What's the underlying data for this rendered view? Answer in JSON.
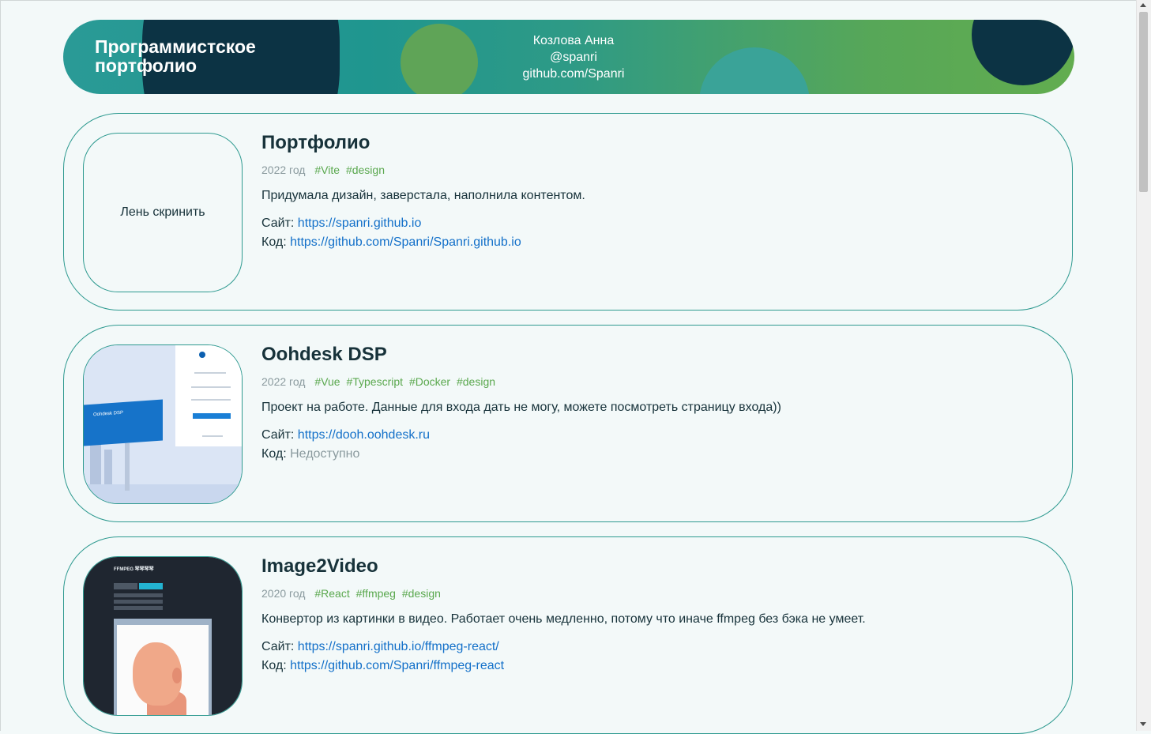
{
  "header": {
    "title": "Программистское портфолио",
    "name": "Козлова Анна",
    "handle": "@spanri",
    "github": "github.com/Spanri"
  },
  "projects": [
    {
      "title": "Портфолио",
      "year": "2022 год",
      "tags": [
        "#Vite",
        "#design"
      ],
      "description": "Придумала дизайн, заверстала, наполнила контентом.",
      "thumb_text": "Лень скринить",
      "site_label": "Сайт:",
      "site": "https://spanri.github.io",
      "code_label": "Код:",
      "code": "https://github.com/Spanri/Spanri.github.io"
    },
    {
      "title": "Oohdesk DSP",
      "year": "2022 год",
      "tags": [
        "#Vue",
        "#Typescript",
        "#Docker",
        "#design"
      ],
      "description": "Проект на работе. Данные для входа дать не могу, можете посмотреть страницу входа))",
      "site_label": "Сайт:",
      "site": "https://dooh.oohdesk.ru",
      "code_label": "Код:",
      "code": "Недоступно",
      "thumb_board_text": "Oohdesk DSP"
    },
    {
      "title": "Image2Video",
      "year": "2020 год",
      "tags": [
        "#React",
        "#ffmpeg",
        "#design"
      ],
      "description": "Конвертор из картинки в видео. Работает очень медленно, потому что иначе ffmpeg без бэка не умеет.",
      "site_label": "Сайт:",
      "site": "https://spanri.github.io/ffmpeg-react/",
      "code_label": "Код:",
      "code": "https://github.com/Spanri/ffmpeg-react",
      "thumb_title": "FFMPEG 琴琴琴琴"
    }
  ],
  "colors": {
    "accent_border": "#2e9a90",
    "dark_navy": "#0c3344",
    "tag_green": "#5aa84e",
    "link_blue": "#1370c9"
  }
}
